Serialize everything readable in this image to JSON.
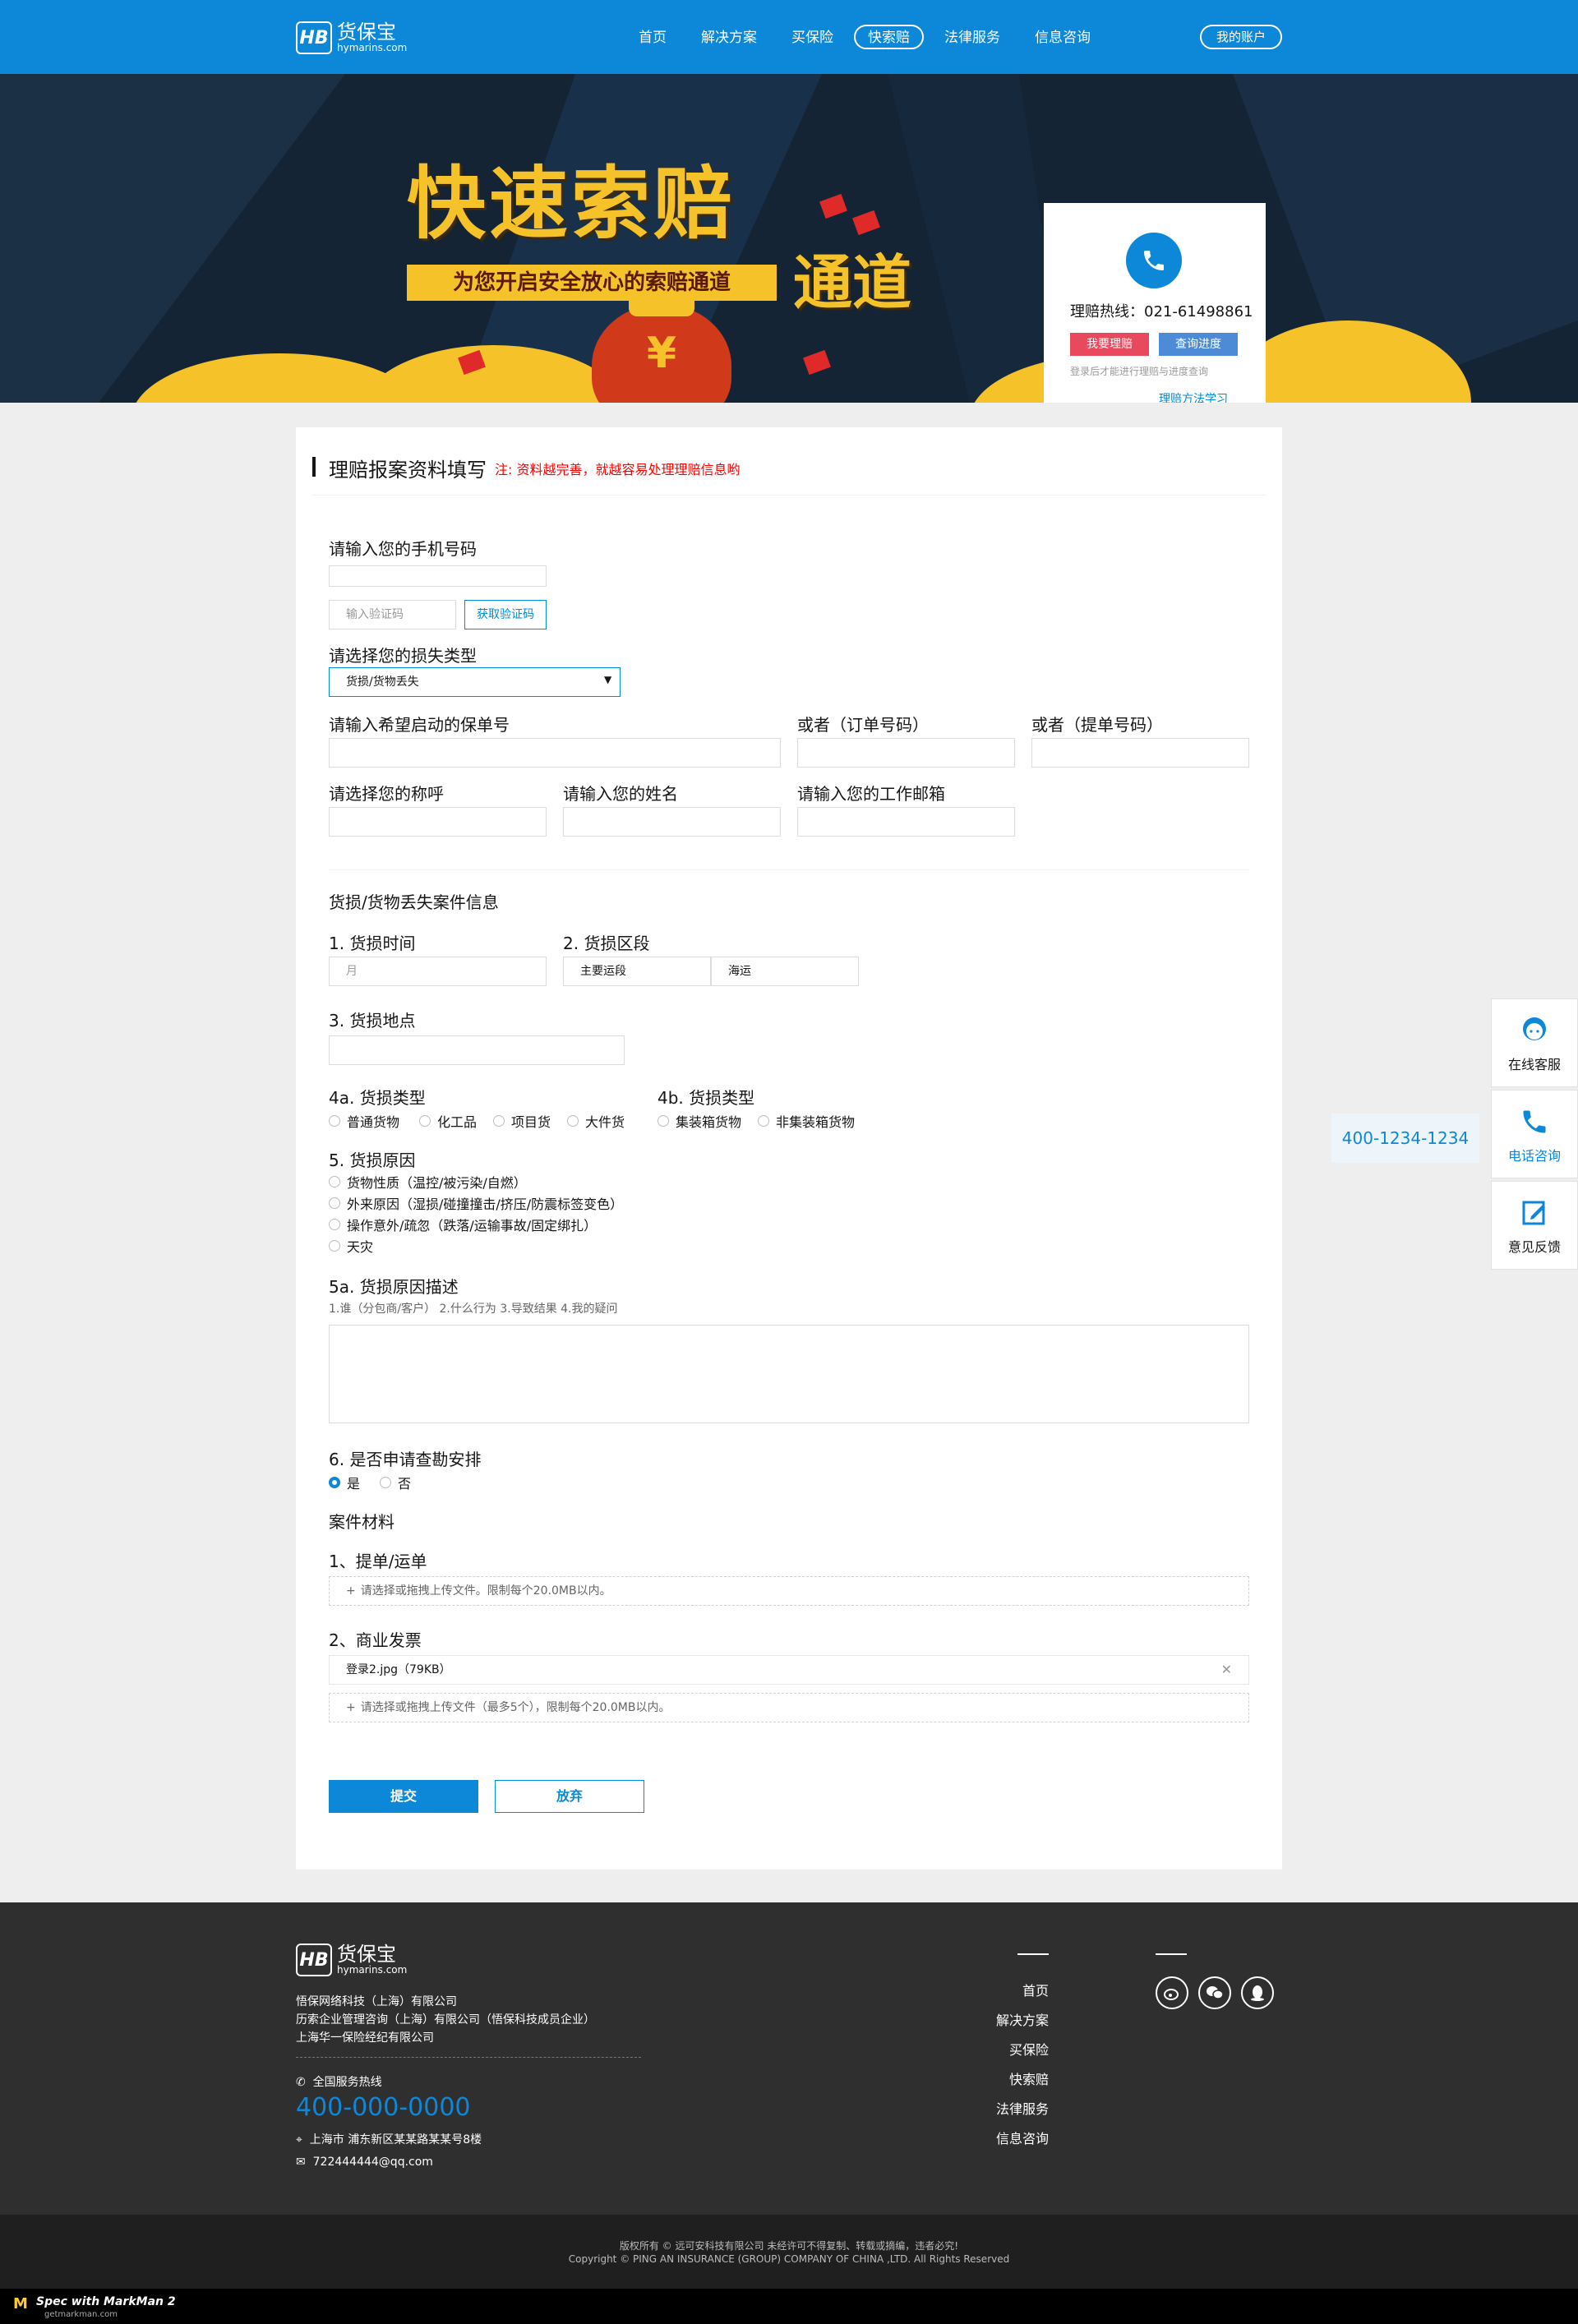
{
  "brand": {
    "name_cn": "货保宝",
    "domain": "hymarins.com",
    "mark": "HB"
  },
  "nav": {
    "items": [
      {
        "label": "首页",
        "active": false
      },
      {
        "label": "解决方案",
        "active": false
      },
      {
        "label": "买保险",
        "active": false
      },
      {
        "label": "快索赔",
        "active": true
      },
      {
        "label": "法律服务",
        "active": false
      },
      {
        "label": "信息咨询",
        "active": false
      }
    ],
    "account": "我的账户"
  },
  "banner": {
    "title": "快速索赔",
    "title_2": "通道",
    "subtitle": "为您开启安全放心的索赔通道",
    "card": {
      "hotline": "理赔热线：021-61498861",
      "claim_btn": "我要理赔",
      "progress_btn": "查询进度",
      "tip": "登录后才能进行理赔与进度查询",
      "link": "理赔方法学习"
    }
  },
  "form": {
    "title": "理赔报案资料填写",
    "note": "注: 资料越完善，就越容易处理理赔信息哟",
    "phone": {
      "label": "请输入您的手机号码",
      "placeholder": "",
      "code_placeholder": "输入验证码",
      "code_btn": "获取验证码"
    },
    "loss_type": {
      "label": "请选择您的损失类型",
      "value": "货损/货物丢失"
    },
    "policy": {
      "label": "请输入希望启动的保单号",
      "or_order": "或者（订单号码）",
      "or_bill": "或者（提单号码）"
    },
    "name_row": {
      "title_label": "请选择您的称呼",
      "name_label": "请输入您的姓名",
      "email_label": "请输入您的工作邮箱"
    },
    "case": {
      "section": "货损/货物丢失案件信息",
      "time_label": "1. 货损时间",
      "time_value": "月",
      "stage_label": "2. 货损区段",
      "stage_main": "主要运段",
      "stage_shipping": "海运",
      "place_label": "3. 货损地点",
      "cargo_type_label": "4a. 货损类型",
      "cargo_types": [
        "普通货物",
        "化工品",
        "项目货",
        "大件货"
      ],
      "container_label": "4b. 货损类型",
      "container_types": [
        "集装箱货物",
        "非集装箱货物"
      ],
      "cause_label": "5. 货损原因",
      "causes": [
        "货物性质（温控/被污染/自燃）",
        "外来原因（湿损/碰撞撞击/挤压/防震标签变色）",
        "操作意外/疏忽（跌落/运输事故/固定绑扎）",
        "天灾"
      ],
      "desc_label": "5a. 货损原因描述",
      "desc_hint": "1.谁（分包商/客户） 2.什么行为 3.导致结果 4.我的疑问",
      "survey_label": "6. 是否申请查勘安排",
      "survey_options": [
        "是",
        "否"
      ]
    },
    "materials": {
      "section": "案件材料",
      "item1": "1、提单/运单",
      "item1_hint": "请选择或拖拽上传文件。限制每个20.0MB以内。",
      "item2": "2、商业发票",
      "file_name": "登录2.jpg（79KB）",
      "item2_hint": "请选择或拖拽上传文件（最多5个），限制每个20.0MB以内。"
    },
    "submit": "提交",
    "cancel": "放弃"
  },
  "float": {
    "service": "在线客服",
    "phone": "电话咨询",
    "feedback": "意见反馈",
    "phone_number": "400-1234-1234"
  },
  "footer": {
    "companies": [
      "悟保网络科技（上海）有限公司",
      "历索企业管理咨询（上海）有限公司（悟保科技成员企业）",
      "上海华一保险经纪有限公司"
    ],
    "service_label": "全国服务热线",
    "tel": "400-000-0000",
    "address": "上海市  浦东新区某某路某某号8楼",
    "email": "722444444@qq.com",
    "links": [
      "首页",
      "解决方案",
      "买保险",
      "快索赔",
      "法律服务",
      "信息咨询"
    ],
    "copyright_1": "版权所有 © 远可安科技有限公司 未经许可不得复制、转载或摘编，违者必究!",
    "copyright_2": "Copyright © PING AN INSURANCE (GROUP) COMPANY OF CHINA ,LTD. All Rights Reserved"
  },
  "spec": {
    "logo": "M",
    "text": "Spec with MarkMan 2",
    "sub": "getmarkman.com"
  },
  "colors": {
    "primary": "#0d87d7",
    "accent": "#f5c22a",
    "alert": "#ff0000",
    "claim": "#e8495d"
  }
}
